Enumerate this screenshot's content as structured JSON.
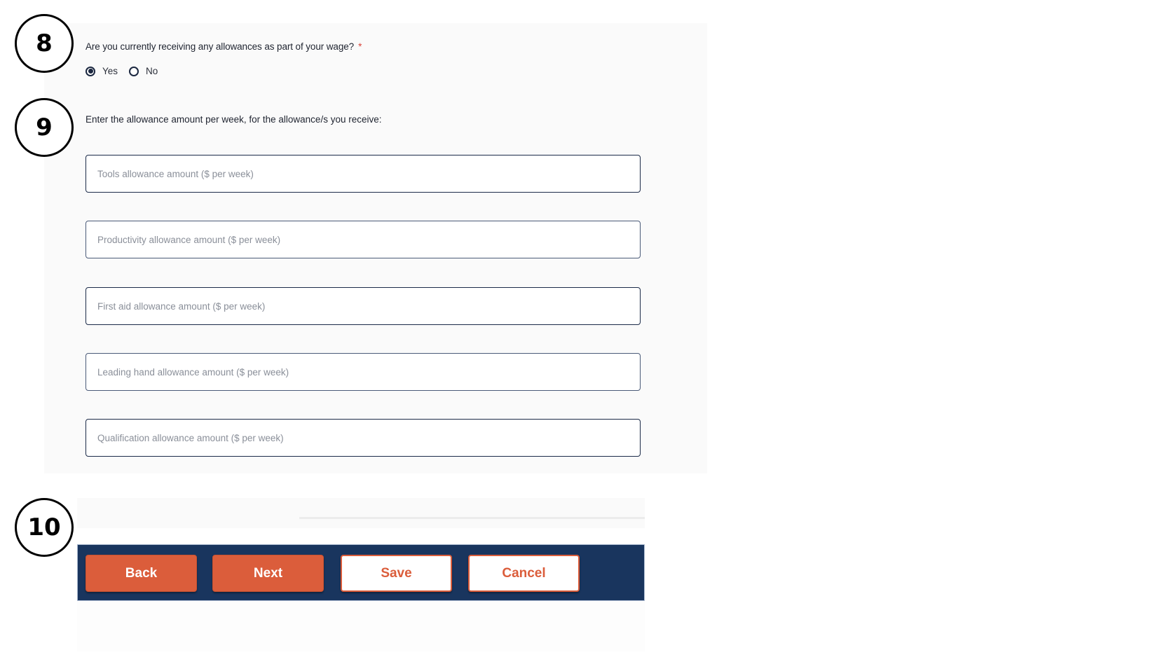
{
  "annotations": {
    "step8": "8",
    "step9": "9",
    "step10": "10"
  },
  "question": {
    "text": "Are you currently receiving any allowances as part of your wage?",
    "required_marker": "*",
    "options": [
      {
        "label": "Yes",
        "selected": true
      },
      {
        "label": "No",
        "selected": false
      }
    ]
  },
  "allowances": {
    "instruction": "Enter the allowance amount per week, for the allowance/s you receive:",
    "fields": [
      {
        "placeholder": "Tools allowance amount ($ per week)",
        "value": ""
      },
      {
        "placeholder": "Productivity allowance amount ($ per week)",
        "value": ""
      },
      {
        "placeholder": "First aid allowance amount ($ per week)",
        "value": ""
      },
      {
        "placeholder": "Leading hand allowance amount ($ per week)",
        "value": ""
      },
      {
        "placeholder": "Qualification allowance amount ($ per week)",
        "value": ""
      }
    ]
  },
  "nav": {
    "back": "Back",
    "next": "Next",
    "save": "Save",
    "cancel": "Cancel"
  },
  "colors": {
    "accent": "#db5d3b",
    "nav_bar": "#19355e",
    "required": "#d9443a",
    "radio": "#1b2740"
  }
}
